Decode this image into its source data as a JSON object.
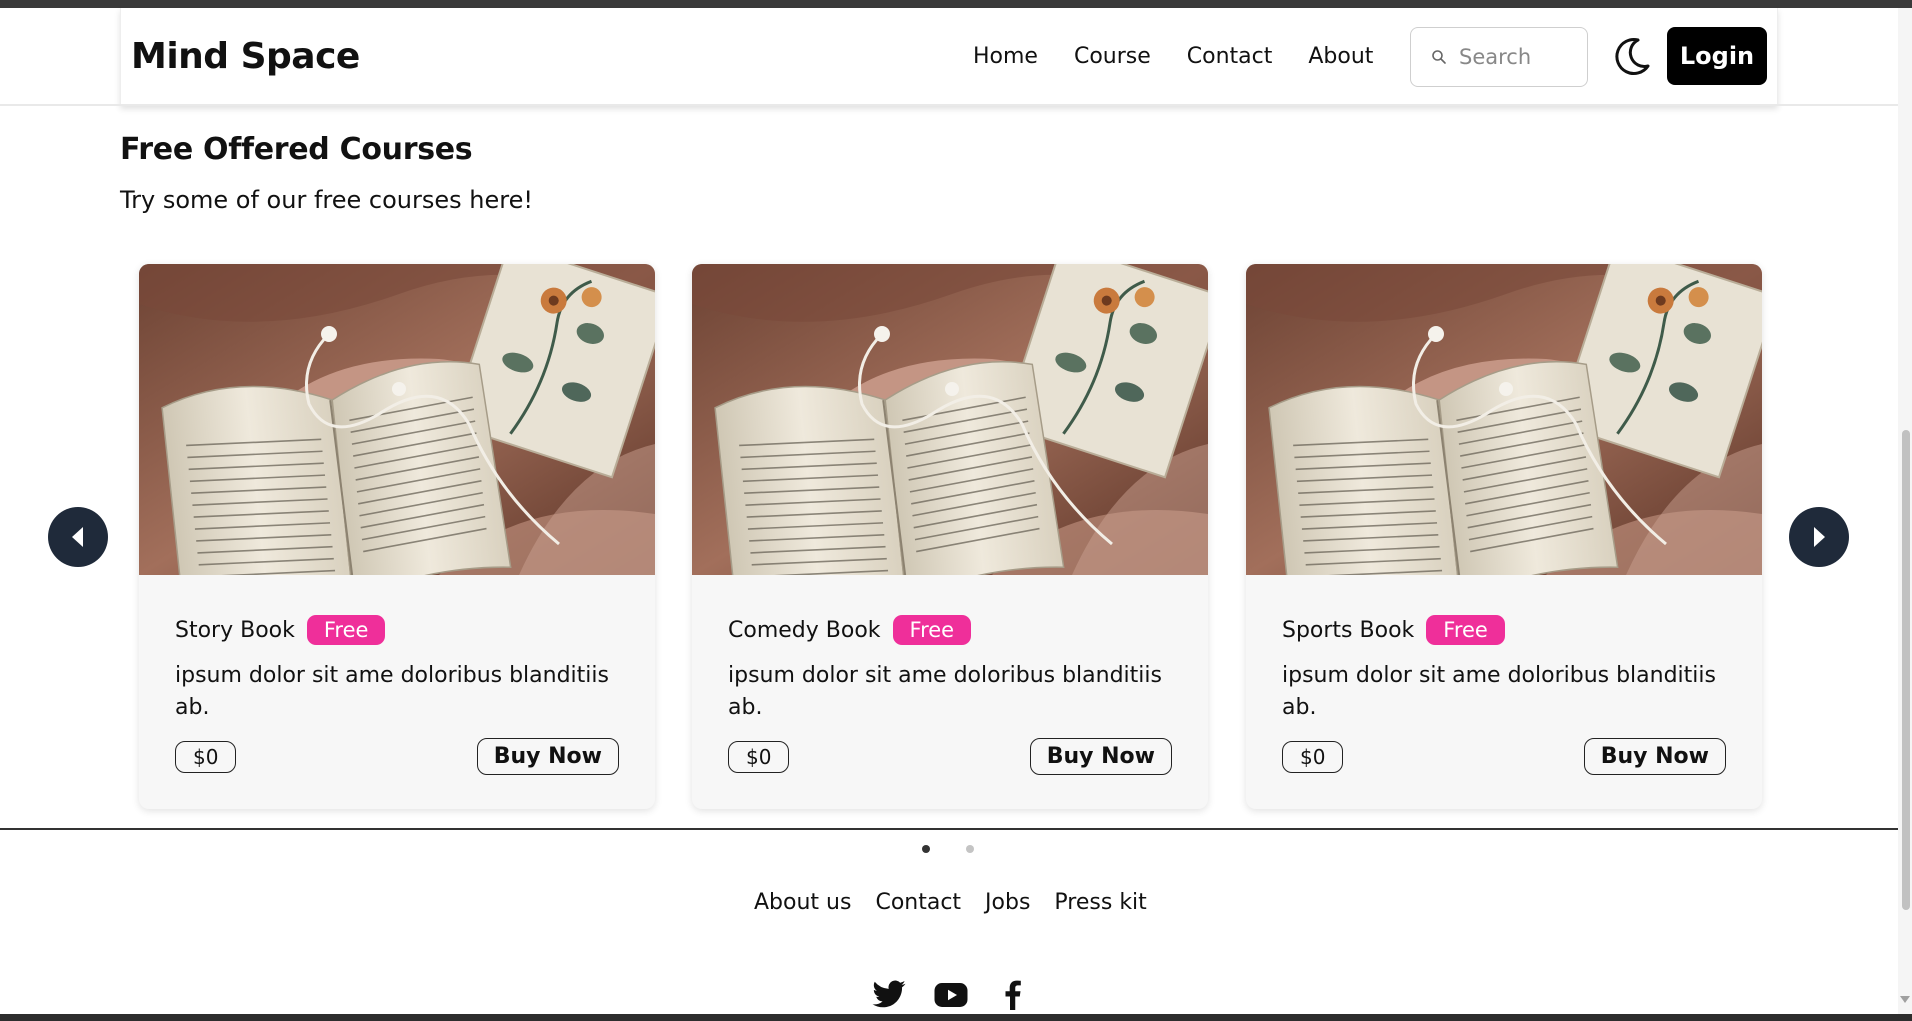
{
  "navbar": {
    "brand": "Mind Space",
    "links": [
      "Home",
      "Course",
      "Contact",
      "About"
    ],
    "search_placeholder": "Search",
    "login_label": "Login",
    "theme_icon": "moon-icon"
  },
  "section": {
    "title": "Free Offered Courses",
    "subtitle": "Try some of our free courses here!"
  },
  "carousel": {
    "prev_icon": "chevron-left-icon",
    "next_icon": "chevron-right-icon",
    "active_dot": 0,
    "dot_count": 2,
    "cards": [
      {
        "title": "Story Book",
        "badge": "Free",
        "description": "ipsum dolor sit ame doloribus blanditiis ab.",
        "price": "$0",
        "button": "Buy Now"
      },
      {
        "title": "Comedy Book",
        "badge": "Free",
        "description": "ipsum dolor sit ame doloribus blanditiis ab.",
        "price": "$0",
        "button": "Buy Now"
      },
      {
        "title": "Sports Book",
        "badge": "Free",
        "description": "ipsum dolor sit ame doloribus blanditiis ab.",
        "price": "$0",
        "button": "Buy Now"
      }
    ]
  },
  "footer": {
    "links": [
      "About us",
      "Contact",
      "Jobs",
      "Press kit"
    ],
    "socials": [
      "twitter-icon",
      "youtube-icon",
      "facebook-icon"
    ]
  },
  "colors": {
    "badge": "#ef2f9a",
    "arrow": "#1f2a3a",
    "login_bg": "#000000"
  }
}
